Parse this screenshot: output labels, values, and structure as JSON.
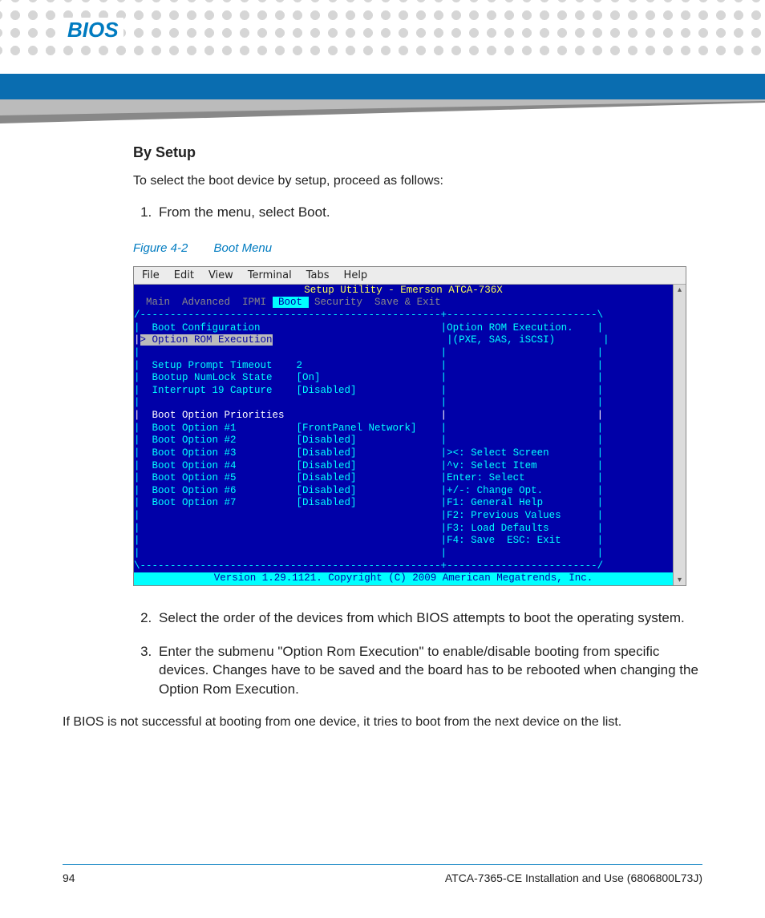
{
  "chapter": "BIOS",
  "section": {
    "heading": "By Setup",
    "intro": "To select the boot device by setup, proceed as follows:",
    "steps": {
      "s1": "From the menu, select Boot.",
      "s2": "Select the order of the devices from which BIOS attempts to boot the operating system.",
      "s3": "Enter the submenu \"Option Rom Execution\" to enable/disable booting from specific devices. Changes have to be saved and the board has to be rebooted when changing the Option Rom Execution."
    },
    "closing": "If BIOS is not successful at booting from one device, it tries to boot from the next device on the list."
  },
  "figure": {
    "label": "Figure 4-2",
    "title": "Boot Menu"
  },
  "terminal": {
    "menubar": [
      "File",
      "Edit",
      "View",
      "Terminal",
      "Tabs",
      "Help"
    ],
    "title": "Setup Utility - Emerson ATCA-736X",
    "tabs_dim_left": "  Main  Advanced  IPMI ",
    "tabs_active": " Boot ",
    "tabs_rest": " Security  Save & Exit",
    "border_top": "/--------------------------------------------------+-------------------------\\",
    "rows": {
      "boot_config": "|  Boot Configuration                              |Option ROM Execution.    |",
      "opt_rom_pre": "|",
      "opt_rom_sel": "> Option ROM Execution",
      "opt_rom_post": "                             |(PXE, SAS, iSCSI)        |",
      "blank1": "|                                                  |                         |",
      "prompt_timeout": "|  Setup Prompt Timeout    2                       |                         |",
      "numlock": "|  Bootup NumLock State    [On]                    |                         |",
      "int19": "|  Interrupt 19 Capture    [Disabled]              |                         |",
      "blank2": "|                                                  |                         |",
      "priorities": "|  Boot Option Priorities                          |                         |",
      "opt1": "|  Boot Option #1          [FrontPanel Network]    |                         |",
      "opt2": "|  Boot Option #2          [Disabled]              |                         |",
      "opt3": "|  Boot Option #3          [Disabled]              |><: Select Screen        |",
      "opt4": "|  Boot Option #4          [Disabled]              |^v: Select Item          |",
      "opt5": "|  Boot Option #5          [Disabled]              |Enter: Select            |",
      "opt6": "|  Boot Option #6          [Disabled]              |+/-: Change Opt.         |",
      "opt7": "|  Boot Option #7          [Disabled]              |F1: General Help         |",
      "help_f2": "|                                                  |F2: Previous Values      |",
      "help_f3": "|                                                  |F3: Load Defaults        |",
      "help_f4": "|                                                  |F4: Save  ESC: Exit      |",
      "blank3": "|                                                  |                         |"
    },
    "border_bot": "\\--------------------------------------------------+-------------------------/",
    "footer": "    Version 1.29.1121. Copyright (C) 2009 American Megatrends, Inc.    "
  },
  "footer": {
    "page": "94",
    "docref": "ATCA-7365-CE Installation and Use (6806800L73J)"
  }
}
